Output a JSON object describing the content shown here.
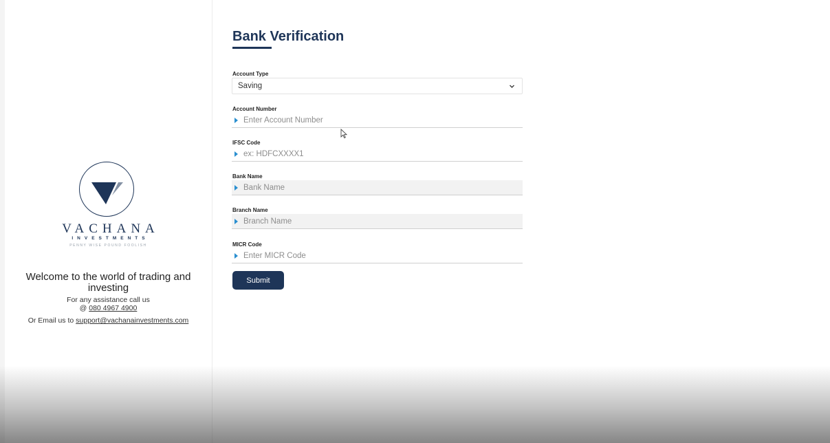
{
  "sidebar": {
    "brand": {
      "name": "VACHANA",
      "sub": "INVESTMENTS",
      "tagline": "PENNY WISE POUND FOOLISH"
    },
    "welcome": "Welcome to the world of trading and investing",
    "assist_text": "For any assistance call us",
    "phone_prefix": "@",
    "phone": "080 4967 4900",
    "email_prefix": "Or Email us to",
    "email": "support@vachanainvestments.com"
  },
  "form": {
    "title": "Bank Verification",
    "account_type": {
      "label": "Account Type",
      "value": "Saving"
    },
    "account_number": {
      "label": "Account Number",
      "placeholder": "Enter Account Number"
    },
    "ifsc": {
      "label": "IFSC Code",
      "placeholder": "ex: HDFCXXXX1"
    },
    "bank_name": {
      "label": "Bank Name",
      "placeholder": "Bank Name"
    },
    "branch_name": {
      "label": "Branch Name",
      "placeholder": "Branch Name"
    },
    "micr": {
      "label": "MICR Code",
      "placeholder": "Enter MICR Code"
    },
    "submit_label": "Submit"
  },
  "colors": {
    "brand_navy": "#1e3558",
    "field_arrow": "#2a8fd0"
  },
  "icons": [
    "vachana-logo-icon",
    "chevron-down-icon",
    "field-arrow-icon",
    "mouse-cursor-icon"
  ]
}
